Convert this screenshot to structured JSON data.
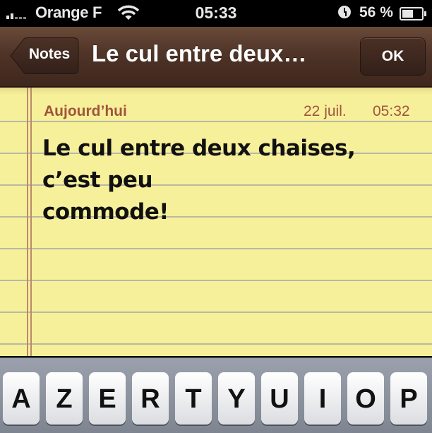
{
  "status_bar": {
    "carrier": "Orange F",
    "time": "05:33",
    "battery_percent": "56 %",
    "battery_level": 0.56,
    "icons": [
      "signal-icon",
      "wifi-icon",
      "alarm-clock-icon",
      "battery-charging-icon"
    ]
  },
  "navbar": {
    "back_label": "Notes",
    "title": "Le cul entre deux…",
    "done_label": "OK"
  },
  "note": {
    "date_label": "Aujourd’hui",
    "date": "22 juil.",
    "time": "05:32",
    "text_line1": "Le cul entre deux chaises, c’est peu",
    "text_line2": "commode!"
  },
  "keyboard": {
    "keys": [
      "A",
      "Z",
      "E",
      "R",
      "T",
      "Y",
      "U",
      "I",
      "O",
      "P"
    ]
  },
  "colors": {
    "paper": "#f7f09a",
    "date_text": "#a0553b",
    "navbar": "#4f3427"
  }
}
